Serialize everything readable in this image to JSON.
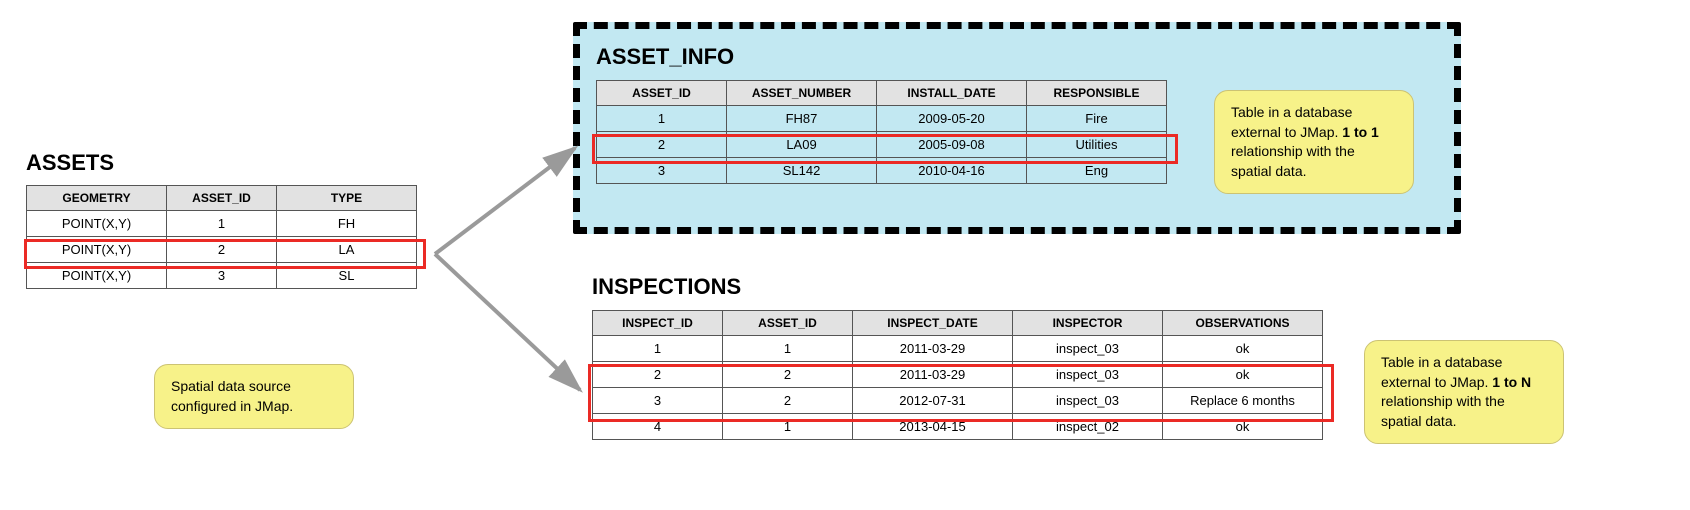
{
  "assets": {
    "title": "ASSETS",
    "columns": [
      "GEOMETRY",
      "ASSET_ID",
      "TYPE"
    ],
    "rows": [
      [
        "POINT(X,Y)",
        "1",
        "FH"
      ],
      [
        "POINT(X,Y)",
        "2",
        "LA"
      ],
      [
        "POINT(X,Y)",
        "3",
        "SL"
      ]
    ],
    "note_prefix": "Spatial data source configured in JMap."
  },
  "asset_info": {
    "title": "ASSET_INFO",
    "columns": [
      "ASSET_ID",
      "ASSET_NUMBER",
      "INSTALL_DATE",
      "RESPONSIBLE"
    ],
    "rows": [
      [
        "1",
        "FH87",
        "2009-05-20",
        "Fire"
      ],
      [
        "2",
        "LA09",
        "2005-09-08",
        "Utilities"
      ],
      [
        "3",
        "SL142",
        "2010-04-16",
        "Eng"
      ]
    ],
    "note_prefix": "Table in a database external to JMap. ",
    "note_bold": "1 to 1",
    "note_suffix": " relationship with the spatial data."
  },
  "inspections": {
    "title": "INSPECTIONS",
    "columns": [
      "INSPECT_ID",
      "ASSET_ID",
      "INSPECT_DATE",
      "INSPECTOR",
      "OBSERVATIONS"
    ],
    "rows": [
      [
        "1",
        "1",
        "2011-03-29",
        "inspect_03",
        "ok"
      ],
      [
        "2",
        "2",
        "2011-03-29",
        "inspect_03",
        "ok"
      ],
      [
        "3",
        "2",
        "2012-07-31",
        "inspect_03",
        "Replace 6 months"
      ],
      [
        "4",
        "1",
        "2013-04-15",
        "inspect_02",
        "ok"
      ]
    ],
    "note_prefix": "Table in a database external to JMap. ",
    "note_bold": "1 to N",
    "note_suffix": " relationship with the spatial data."
  }
}
